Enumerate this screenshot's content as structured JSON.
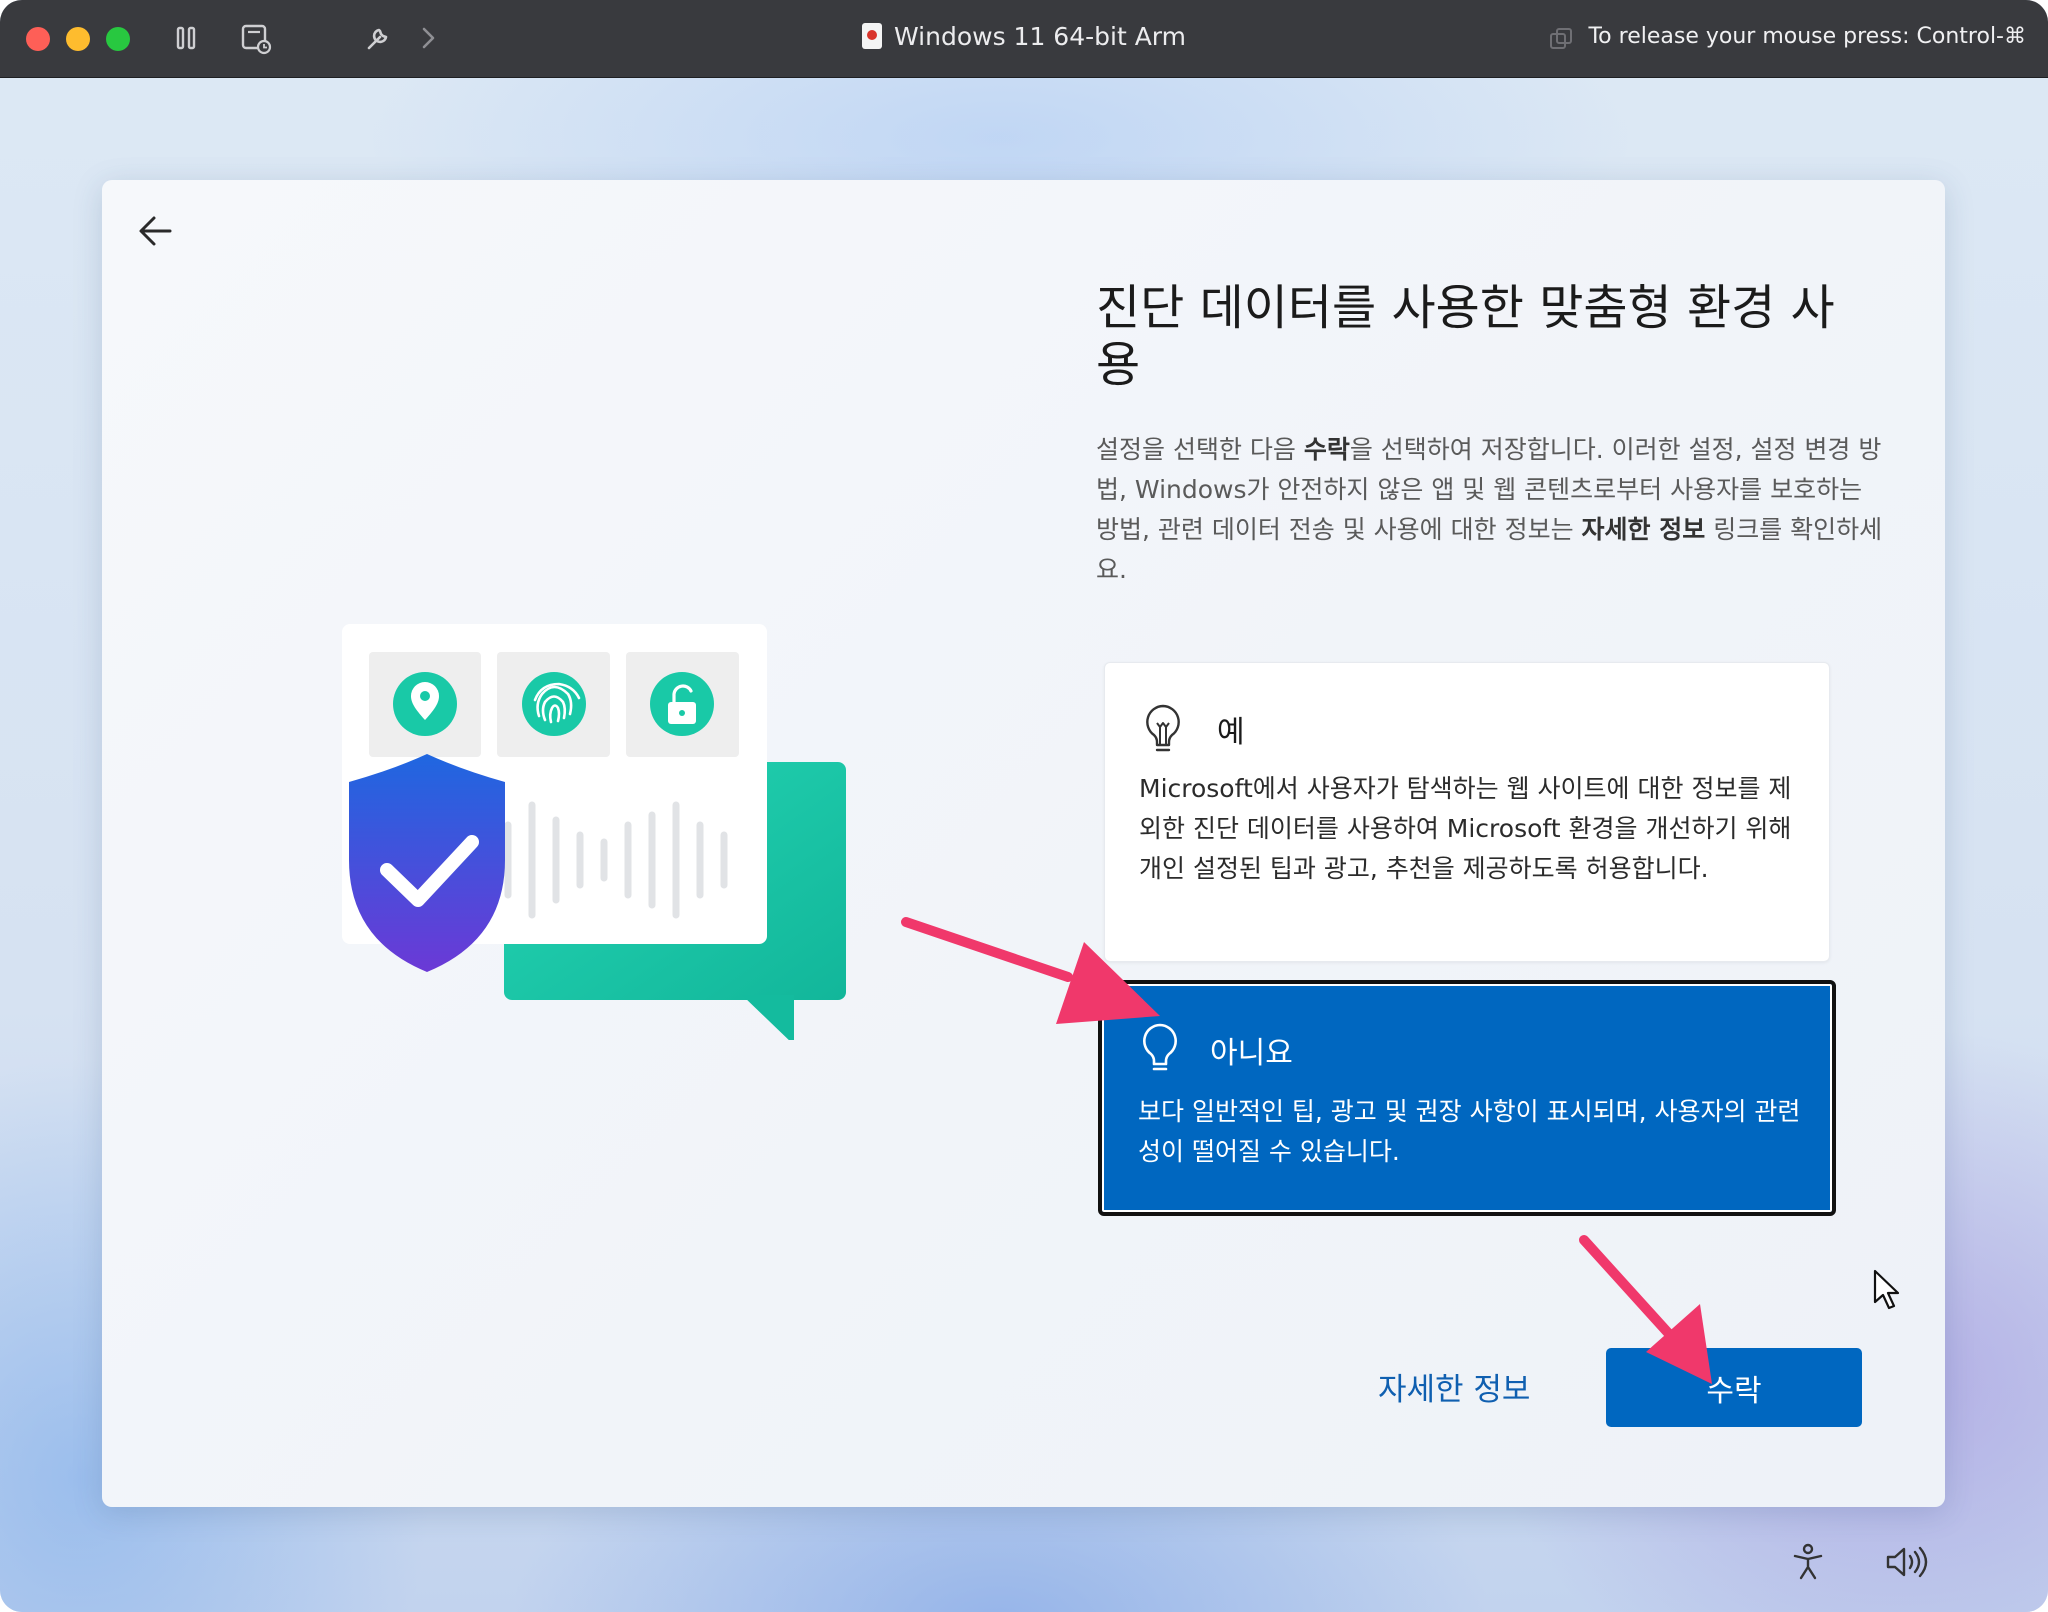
{
  "titlebar": {
    "title": "Windows 11 64-bit Arm",
    "release_hint": "To release your mouse press: Control-⌘"
  },
  "dialog": {
    "title": "진단 데이터를 사용한 맞춤형 환경 사용",
    "description": {
      "part1": "설정을 선택한 다음 ",
      "accept_word": "수락",
      "part2": "을 선택하여 저장합니다. 이러한 설정, 설정 변경 방법, Windows가 안전하지 않은 앱 및 웹 콘텐츠로부터 사용자를 보호하는 방법, 관련 데이터 전송 및 사용에 대한 정보는 ",
      "learn_more_word": "자세한 정보",
      "part3": " 링크를 확인하세요."
    },
    "options": [
      {
        "title": "예",
        "description": "Microsoft에서 사용자가 탐색하는 웹 사이트에 대한 정보를 제외한 진단 데이터를 사용하여 Microsoft 환경을 개선하기 위해 개인 설정된 팁과 광고, 추천을 제공하도록 허용합니다.",
        "selected": false
      },
      {
        "title": "아니요",
        "description": "보다 일반적인 팁, 광고 및 권장 사항이 표시되며, 사용자의 관련성이 떨어질 수 있습니다.",
        "selected": true
      }
    ],
    "learn_more_label": "자세한 정보",
    "accept_label": "수락"
  },
  "colors": {
    "accent": "#0067c0",
    "annotation_arrow": "#f0386b",
    "illustration_teal": "#1fc8a8",
    "shield_blue": "#2b5ce6"
  },
  "icons": [
    "back-arrow-icon",
    "lightbulb-icon",
    "location-pin-icon",
    "fingerprint-icon",
    "unlock-icon",
    "shield-check-icon",
    "accessibility-icon",
    "volume-icon",
    "mouse-cursor-icon"
  ]
}
